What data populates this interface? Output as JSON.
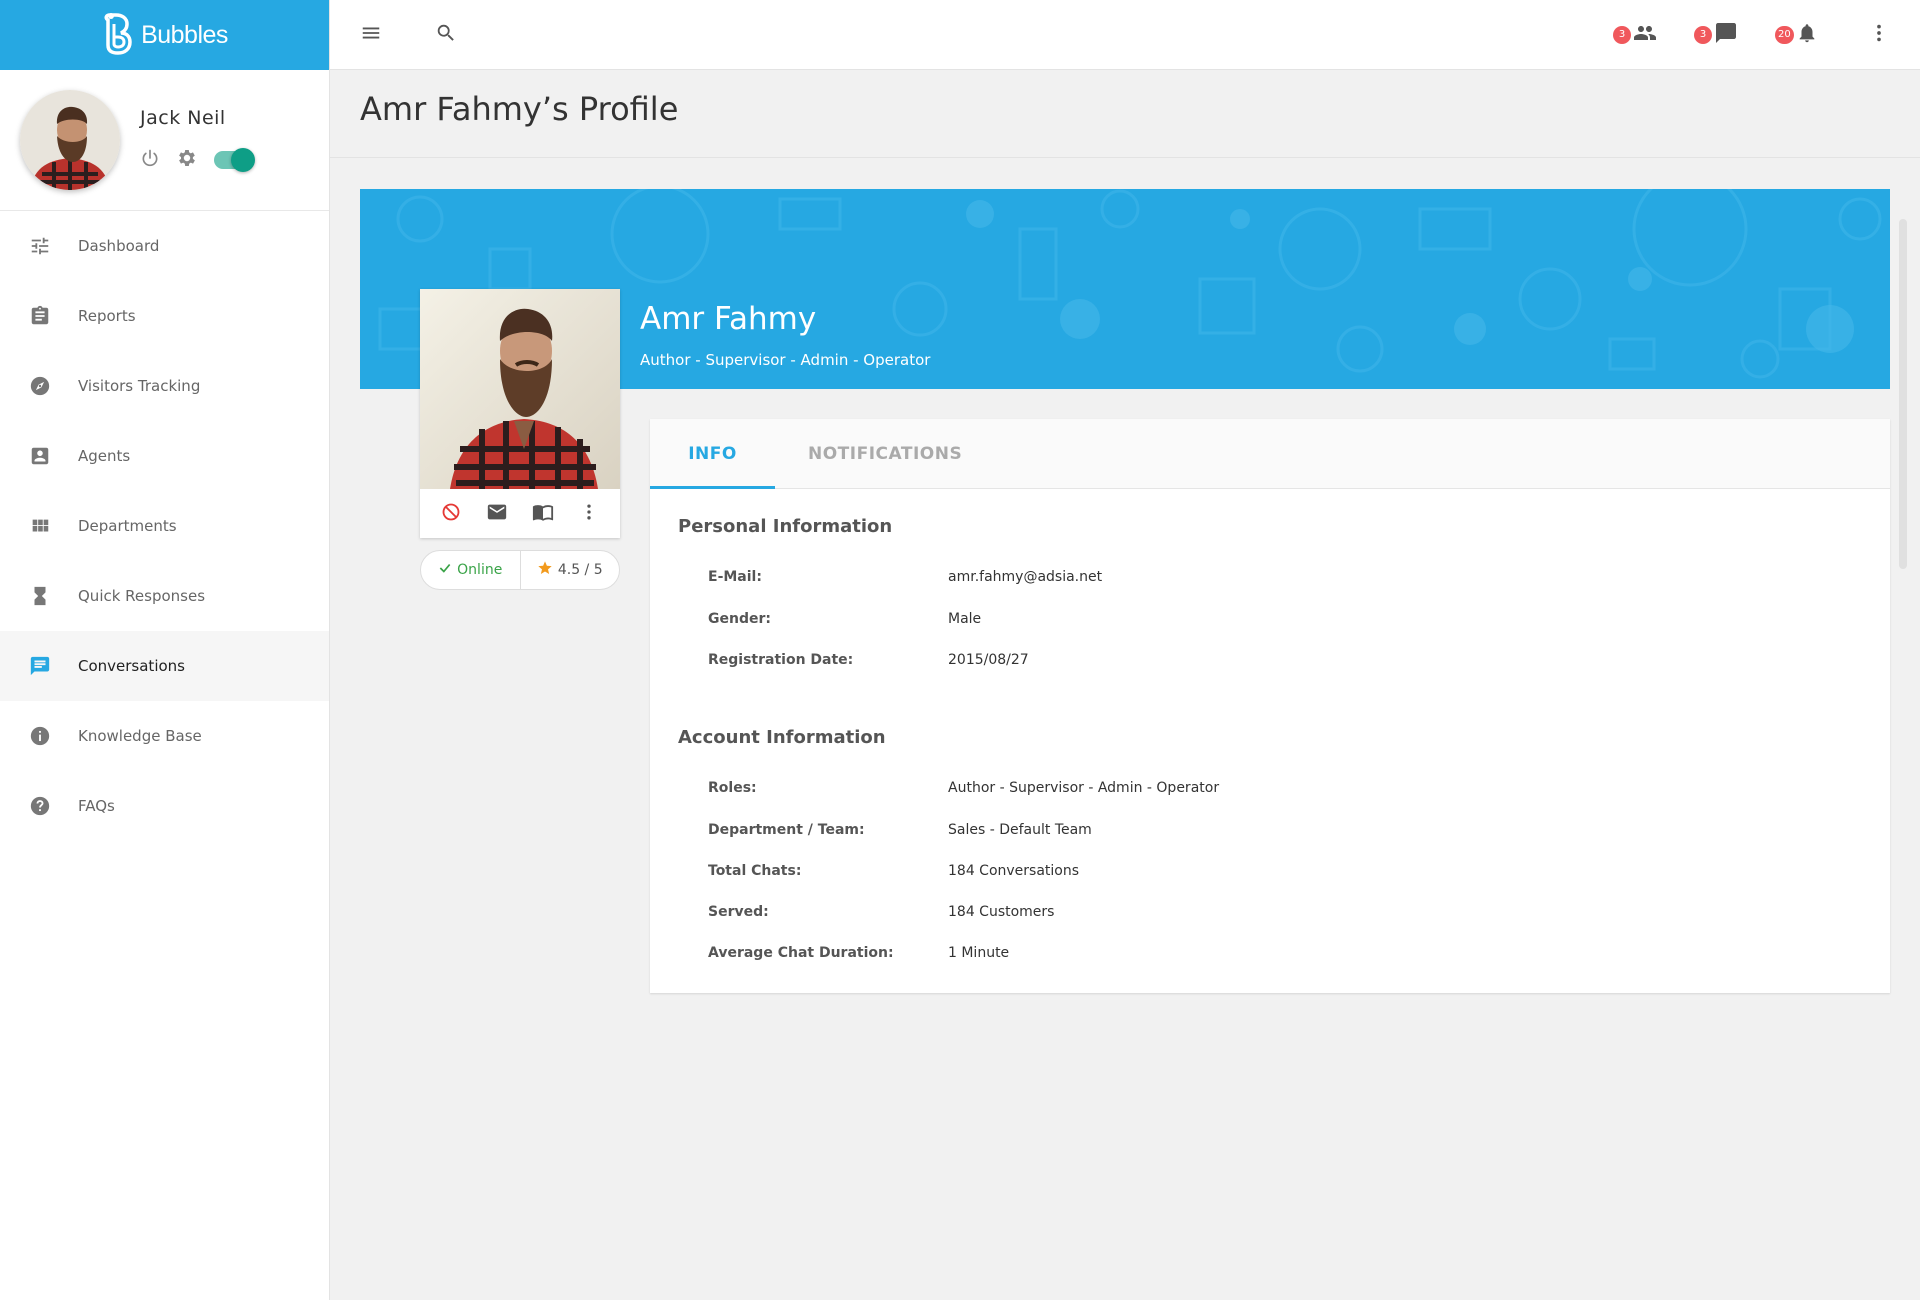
{
  "app": {
    "brand": "Bubbles"
  },
  "user": {
    "name": "Jack Neil",
    "status_toggle": "on"
  },
  "sidebar": {
    "items": [
      {
        "label": "Dashboard",
        "icon": "tune-icon"
      },
      {
        "label": "Reports",
        "icon": "clipboard-icon"
      },
      {
        "label": "Visitors Tracking",
        "icon": "compass-icon"
      },
      {
        "label": "Agents",
        "icon": "contact-card-icon"
      },
      {
        "label": "Departments",
        "icon": "grid-icon"
      },
      {
        "label": "Quick Responses",
        "icon": "hourglass-icon"
      },
      {
        "label": "Conversations",
        "icon": "chat-icon",
        "active": true
      },
      {
        "label": "Knowledge Base",
        "icon": "info-icon"
      },
      {
        "label": "FAQs",
        "icon": "help-icon"
      }
    ]
  },
  "topbar": {
    "agents_count": "3",
    "messages_count": "3",
    "notifications_count": "20"
  },
  "page": {
    "title": "Amr Fahmy’s Profile"
  },
  "profile": {
    "name": "Amr Fahmy",
    "roles": "Author - Supervisor - Admin - Operator",
    "status": "Online",
    "rating": "4.5 / 5"
  },
  "tabs": {
    "info": "INFO",
    "notifications": "NOTIFICATIONS"
  },
  "personal": {
    "title": "Personal Information",
    "rows": [
      {
        "label": "E-Mail:",
        "value": "amr.fahmy@adsia.net"
      },
      {
        "label": "Gender:",
        "value": "Male"
      },
      {
        "label": "Registration Date:",
        "value": "2015/08/27"
      }
    ]
  },
  "account": {
    "title": "Account Information",
    "rows": [
      {
        "label": "Roles:",
        "value": "Author - Supervisor - Admin - Operator"
      },
      {
        "label": "Department / Team:",
        "value": "Sales - Default Team"
      },
      {
        "label": "Total Chats:",
        "value": "184 Conversations"
      },
      {
        "label": "Served:",
        "value": "184 Customers"
      },
      {
        "label": "Average Chat Duration:",
        "value": "1 Minute"
      }
    ]
  },
  "colors": {
    "primary": "#26a8e2",
    "badge": "#f0585c",
    "online": "#3aa348",
    "toggle": "#0e9e86"
  }
}
